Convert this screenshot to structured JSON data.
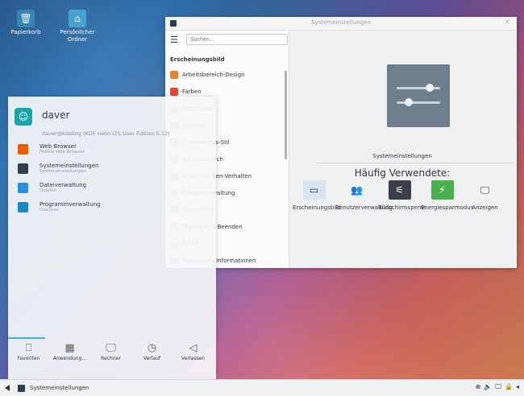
{
  "desktop": {
    "icons": [
      {
        "label": "Papierkorb",
        "icon": "trash-icon"
      },
      {
        "label": "Persönlicher Ordner",
        "icon": "home-folder-icon"
      }
    ]
  },
  "settings_window": {
    "title": "Systemeinstellungen",
    "search_placeholder": "Suchen...",
    "category": "Erscheinungsbild",
    "sidebar_items": [
      {
        "label": "Arbeitsbereich-Design",
        "color": "#e0872a"
      },
      {
        "label": "Farben",
        "color": "#e8452f"
      },
      {
        "label": "Schriftarten",
        "color": "#b0b4b8"
      },
      {
        "label": "Symbole",
        "color": "#b0b4b8"
      },
      {
        "label": "Anwendungs-Stil",
        "color": "#b0b4b8"
      },
      {
        "label": "Arbeitsbereich",
        "color": "#b0b4b8"
      },
      {
        "label": "Arbeitsflächen-Verhalten",
        "color": "#b0b4b8"
      },
      {
        "label": "Fensterverwaltung",
        "color": "#b0b4b8"
      },
      {
        "label": "Kurzbefehle",
        "color": "#b0b4b8"
      },
      {
        "label": "Starten und Beenden",
        "color": "#b0b4b8"
      },
      {
        "label": "Suche",
        "color": "#b0b4b8"
      },
      {
        "label": "Persönliche Informationen",
        "color": "#b0b4b8"
      }
    ],
    "hero_caption": "Systemeinstellungen",
    "frequent_title": "Häufig Verwendete:",
    "frequent": [
      {
        "label": "Erscheinungsbild",
        "icon": "window-icon",
        "color": "#d6e4ef"
      },
      {
        "label": "Benutzerverwaltung",
        "icon": "users-icon",
        "color": "#eff0f1"
      },
      {
        "label": "Bildschirmsperre",
        "icon": "screen-lock-icon",
        "color": "#3b4046"
      },
      {
        "label": "Energiesparmodus",
        "icon": "power-icon",
        "color": "#4caf50"
      },
      {
        "label": "Anzeigen",
        "icon": "monitor-icon",
        "color": "#eff0f1"
      }
    ]
  },
  "launcher": {
    "username": "daver",
    "user_subtitle": "daver@kdeling (KDE neon LTS User Edition 5.12)",
    "apps": [
      {
        "name": "Web Browser",
        "desc": "Firefox Web Browser",
        "color": "#e66000"
      },
      {
        "name": "Systemeinstellungen",
        "desc": "Systemeinstellungen",
        "color": "#2c3e50"
      },
      {
        "name": "Dateiverwaltung",
        "desc": "Dolphin",
        "color": "#2a8fd6"
      },
      {
        "name": "Programmverwaltung",
        "desc": "Discover",
        "color": "#1e88c7"
      }
    ],
    "tabs": [
      {
        "label": "Favoriten",
        "icon": "bookmark-icon",
        "glyph": "⎕"
      },
      {
        "label": "Anwendung...",
        "icon": "grid-icon",
        "glyph": "▦"
      },
      {
        "label": "Rechner",
        "icon": "computer-icon",
        "glyph": "🖵"
      },
      {
        "label": "Verlauf",
        "icon": "history-icon",
        "glyph": "◷"
      },
      {
        "label": "Verlassen",
        "icon": "leave-icon",
        "glyph": "◁"
      }
    ]
  },
  "taskbar": {
    "task_label": "Systemeinstellungen",
    "tray": [
      "⊕",
      "🔈",
      "🖵",
      "🔒",
      "◂"
    ]
  }
}
